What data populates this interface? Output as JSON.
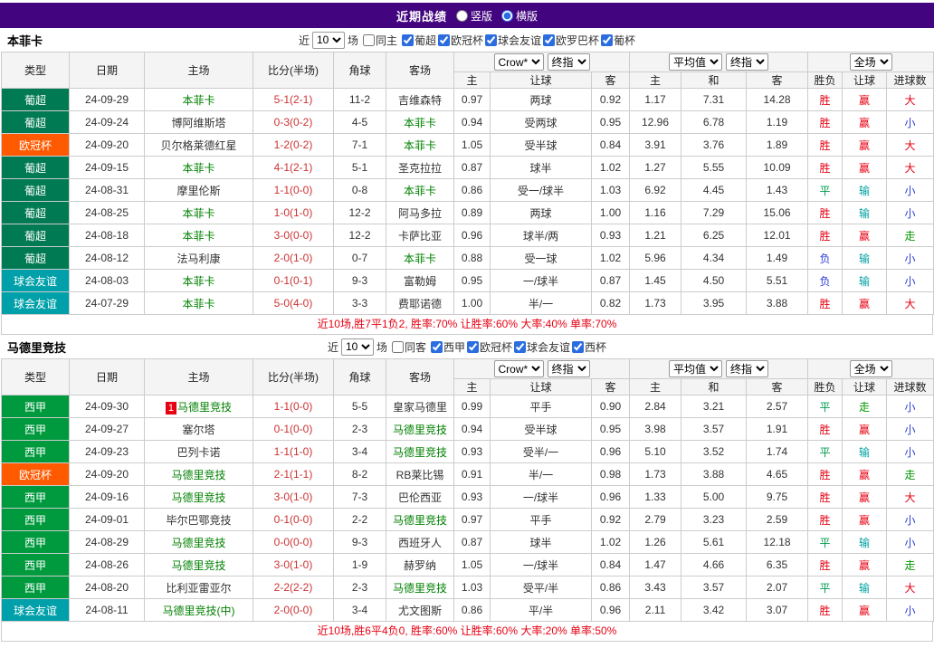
{
  "header": {
    "title": "近期战绩",
    "layout_options": [
      "竖版",
      "横版"
    ],
    "selected_layout": "横版"
  },
  "colors": {
    "topbar_bg": "#43057f",
    "score_text": "#cc3333",
    "team_highlight": "#008000",
    "summary_text": "#e60012",
    "league": {
      "葡超": "#007a52",
      "欧冠杯": "#ff5a00",
      "球会友谊": "#00a0aa",
      "西甲": "#009a3e"
    },
    "outcome": {
      "胜": "#e60012",
      "平": "#009a4d",
      "负": "#2a3cd4",
      "赢": "#e60012",
      "输": "#00a0a0",
      "走": "#009900",
      "大": "#e60012",
      "小": "#2a3cd4"
    }
  },
  "table_header": {
    "left_cols": [
      "类型",
      "日期",
      "主场",
      "比分(半场)",
      "角球",
      "客场"
    ],
    "group1": [
      "Crow*",
      "终指"
    ],
    "group2": [
      "平均值",
      "终指"
    ],
    "group3": [
      "全场"
    ],
    "sub_cols": [
      "主",
      "让球",
      "客",
      "主",
      "和",
      "客",
      "胜负",
      "让球",
      "进球数"
    ]
  },
  "sections": [
    {
      "team": "本菲卡",
      "filter": {
        "near": "近",
        "count": "10",
        "games": "场",
        "same": "同主",
        "leagues": [
          "葡超",
          "欧冠杯",
          "球会友谊",
          "欧罗巴杯",
          "葡杯"
        ]
      },
      "rows": [
        {
          "league": "葡超",
          "date": "24-09-29",
          "home": "本菲卡",
          "home_hl": true,
          "score": "5-1(2-1)",
          "corners": "11-2",
          "away": "吉维森特",
          "away_hl": false,
          "odds": [
            "0.97",
            "两球",
            "0.92"
          ],
          "avg": [
            "1.17",
            "7.31",
            "14.28"
          ],
          "results": [
            "胜",
            "赢",
            "大"
          ]
        },
        {
          "league": "葡超",
          "date": "24-09-24",
          "home": "博阿维斯塔",
          "home_hl": false,
          "score": "0-3(0-2)",
          "corners": "4-5",
          "away": "本菲卡",
          "away_hl": true,
          "odds": [
            "0.94",
            "受两球",
            "0.95"
          ],
          "avg": [
            "12.96",
            "6.78",
            "1.19"
          ],
          "results": [
            "胜",
            "赢",
            "小"
          ]
        },
        {
          "league": "欧冠杯",
          "date": "24-09-20",
          "home": "贝尔格莱德红星",
          "home_hl": false,
          "score": "1-2(0-2)",
          "corners": "7-1",
          "away": "本菲卡",
          "away_hl": true,
          "odds": [
            "1.05",
            "受半球",
            "0.84"
          ],
          "avg": [
            "3.91",
            "3.76",
            "1.89"
          ],
          "results": [
            "胜",
            "赢",
            "大"
          ]
        },
        {
          "league": "葡超",
          "date": "24-09-15",
          "home": "本菲卡",
          "home_hl": true,
          "score": "4-1(2-1)",
          "corners": "5-1",
          "away": "圣克拉拉",
          "away_hl": false,
          "odds": [
            "0.87",
            "球半",
            "1.02"
          ],
          "avg": [
            "1.27",
            "5.55",
            "10.09"
          ],
          "results": [
            "胜",
            "赢",
            "大"
          ]
        },
        {
          "league": "葡超",
          "date": "24-08-31",
          "home": "摩里伦斯",
          "home_hl": false,
          "score": "1-1(0-0)",
          "corners": "0-8",
          "away": "本菲卡",
          "away_hl": true,
          "odds": [
            "0.86",
            "受一/球半",
            "1.03"
          ],
          "avg": [
            "6.92",
            "4.45",
            "1.43"
          ],
          "results": [
            "平",
            "输",
            "小"
          ]
        },
        {
          "league": "葡超",
          "date": "24-08-25",
          "home": "本菲卡",
          "home_hl": true,
          "score": "1-0(1-0)",
          "corners": "12-2",
          "away": "阿马多拉",
          "away_hl": false,
          "odds": [
            "0.89",
            "两球",
            "1.00"
          ],
          "avg": [
            "1.16",
            "7.29",
            "15.06"
          ],
          "results": [
            "胜",
            "输",
            "小"
          ]
        },
        {
          "league": "葡超",
          "date": "24-08-18",
          "home": "本菲卡",
          "home_hl": true,
          "score": "3-0(0-0)",
          "corners": "12-2",
          "away": "卡萨比亚",
          "away_hl": false,
          "odds": [
            "0.96",
            "球半/两",
            "0.93"
          ],
          "avg": [
            "1.21",
            "6.25",
            "12.01"
          ],
          "results": [
            "胜",
            "赢",
            "走"
          ]
        },
        {
          "league": "葡超",
          "date": "24-08-12",
          "home": "法马利康",
          "home_hl": false,
          "score": "2-0(1-0)",
          "corners": "0-7",
          "away": "本菲卡",
          "away_hl": true,
          "odds": [
            "0.88",
            "受一球",
            "1.02"
          ],
          "avg": [
            "5.96",
            "4.34",
            "1.49"
          ],
          "results": [
            "负",
            "输",
            "小"
          ]
        },
        {
          "league": "球会友谊",
          "date": "24-08-03",
          "home": "本菲卡",
          "home_hl": true,
          "score": "0-1(0-1)",
          "corners": "9-3",
          "away": "富勒姆",
          "away_hl": false,
          "odds": [
            "0.95",
            "一/球半",
            "0.87"
          ],
          "avg": [
            "1.45",
            "4.50",
            "5.51"
          ],
          "results": [
            "负",
            "输",
            "小"
          ]
        },
        {
          "league": "球会友谊",
          "date": "24-07-29",
          "home": "本菲卡",
          "home_hl": true,
          "score": "5-0(4-0)",
          "corners": "3-3",
          "away": "费耶诺德",
          "away_hl": false,
          "odds": [
            "1.00",
            "半/一",
            "0.82"
          ],
          "avg": [
            "1.73",
            "3.95",
            "3.88"
          ],
          "results": [
            "胜",
            "赢",
            "大"
          ]
        }
      ],
      "summary": "近10场,胜7平1负2, 胜率:70% 让胜率:60% 大率:40% 单率:70%"
    },
    {
      "team": "马德里竞技",
      "filter": {
        "near": "近",
        "count": "10",
        "games": "场",
        "same": "同客",
        "leagues": [
          "西甲",
          "欧冠杯",
          "球会友谊",
          "西杯"
        ]
      },
      "rows": [
        {
          "league": "西甲",
          "date": "24-09-30",
          "home": "马德里竞技",
          "home_hl": true,
          "home_badge": "1",
          "score": "1-1(0-0)",
          "corners": "5-5",
          "away": "皇家马德里",
          "away_hl": false,
          "odds": [
            "0.99",
            "平手",
            "0.90"
          ],
          "avg": [
            "2.84",
            "3.21",
            "2.57"
          ],
          "results": [
            "平",
            "走",
            "小"
          ]
        },
        {
          "league": "西甲",
          "date": "24-09-27",
          "home": "塞尔塔",
          "home_hl": false,
          "score": "0-1(0-0)",
          "corners": "2-3",
          "away": "马德里竞技",
          "away_hl": true,
          "odds": [
            "0.94",
            "受半球",
            "0.95"
          ],
          "avg": [
            "3.98",
            "3.57",
            "1.91"
          ],
          "results": [
            "胜",
            "赢",
            "小"
          ]
        },
        {
          "league": "西甲",
          "date": "24-09-23",
          "home": "巴列卡诺",
          "home_hl": false,
          "score": "1-1(1-0)",
          "corners": "3-4",
          "away": "马德里竞技",
          "away_hl": true,
          "odds": [
            "0.93",
            "受半/一",
            "0.96"
          ],
          "avg": [
            "5.10",
            "3.52",
            "1.74"
          ],
          "results": [
            "平",
            "输",
            "小"
          ]
        },
        {
          "league": "欧冠杯",
          "date": "24-09-20",
          "home": "马德里竞技",
          "home_hl": true,
          "score": "2-1(1-1)",
          "corners": "8-2",
          "away": "RB莱比锡",
          "away_hl": false,
          "odds": [
            "0.91",
            "半/一",
            "0.98"
          ],
          "avg": [
            "1.73",
            "3.88",
            "4.65"
          ],
          "results": [
            "胜",
            "赢",
            "走"
          ]
        },
        {
          "league": "西甲",
          "date": "24-09-16",
          "home": "马德里竞技",
          "home_hl": true,
          "score": "3-0(1-0)",
          "corners": "7-3",
          "away": "巴伦西亚",
          "away_hl": false,
          "odds": [
            "0.93",
            "一/球半",
            "0.96"
          ],
          "avg": [
            "1.33",
            "5.00",
            "9.75"
          ],
          "results": [
            "胜",
            "赢",
            "大"
          ]
        },
        {
          "league": "西甲",
          "date": "24-09-01",
          "home": "毕尔巴鄂竞技",
          "home_hl": false,
          "score": "0-1(0-0)",
          "corners": "2-2",
          "away": "马德里竞技",
          "away_hl": true,
          "odds": [
            "0.97",
            "平手",
            "0.92"
          ],
          "avg": [
            "2.79",
            "3.23",
            "2.59"
          ],
          "results": [
            "胜",
            "赢",
            "小"
          ]
        },
        {
          "league": "西甲",
          "date": "24-08-29",
          "home": "马德里竞技",
          "home_hl": true,
          "score": "0-0(0-0)",
          "corners": "9-3",
          "away": "西班牙人",
          "away_hl": false,
          "odds": [
            "0.87",
            "球半",
            "1.02"
          ],
          "avg": [
            "1.26",
            "5.61",
            "12.18"
          ],
          "results": [
            "平",
            "输",
            "小"
          ]
        },
        {
          "league": "西甲",
          "date": "24-08-26",
          "home": "马德里竞技",
          "home_hl": true,
          "score": "3-0(1-0)",
          "corners": "1-9",
          "away": "赫罗纳",
          "away_hl": false,
          "odds": [
            "1.05",
            "一/球半",
            "0.84"
          ],
          "avg": [
            "1.47",
            "4.66",
            "6.35"
          ],
          "results": [
            "胜",
            "赢",
            "走"
          ]
        },
        {
          "league": "西甲",
          "date": "24-08-20",
          "home": "比利亚雷亚尔",
          "home_hl": false,
          "score": "2-2(2-2)",
          "corners": "2-3",
          "away": "马德里竞技",
          "away_hl": true,
          "odds": [
            "1.03",
            "受平/半",
            "0.86"
          ],
          "avg": [
            "3.43",
            "3.57",
            "2.07"
          ],
          "results": [
            "平",
            "输",
            "大"
          ]
        },
        {
          "league": "球会友谊",
          "date": "24-08-11",
          "home": "马德里竞技(中)",
          "home_hl": true,
          "score": "2-0(0-0)",
          "corners": "3-4",
          "away": "尤文图斯",
          "away_hl": false,
          "odds": [
            "0.86",
            "平/半",
            "0.96"
          ],
          "avg": [
            "2.11",
            "3.42",
            "3.07"
          ],
          "results": [
            "胜",
            "赢",
            "小"
          ]
        }
      ],
      "summary": "近10场,胜6平4负0, 胜率:60% 让胜率:60% 大率:20% 单率:50%"
    }
  ]
}
